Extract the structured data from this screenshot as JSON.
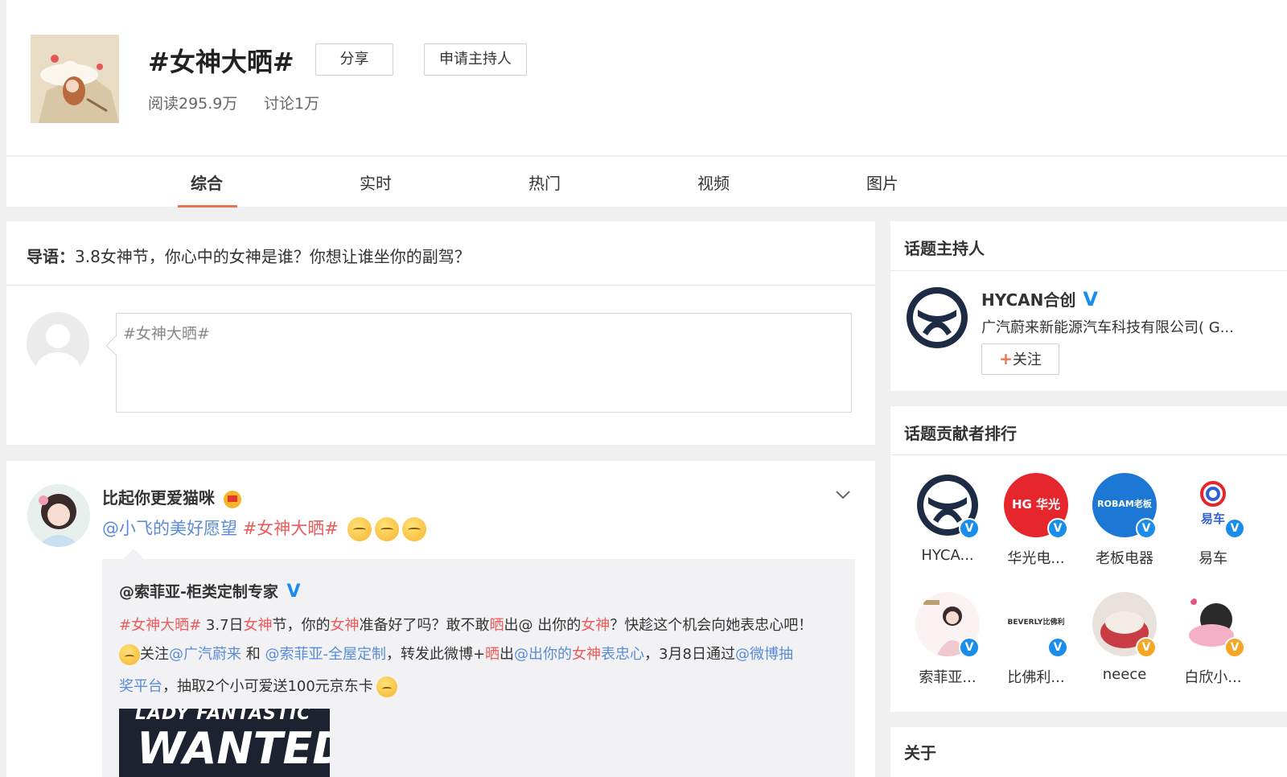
{
  "topic": {
    "title": "#女神大晒#",
    "share_label": "分享",
    "apply_host_label": "申请主持人",
    "read_stat": "阅读295.9万",
    "discuss_stat": "讨论1万"
  },
  "tabs": [
    {
      "label": "综合",
      "active": true
    },
    {
      "label": "实时",
      "active": false
    },
    {
      "label": "热门",
      "active": false
    },
    {
      "label": "视频",
      "active": false
    },
    {
      "label": "图片",
      "active": false
    }
  ],
  "intro": {
    "prefix": "导语：",
    "text": "3.8女神节，你心中的女神是谁？你想让谁坐你的副驾？"
  },
  "composer": {
    "value": "#女神大晒#"
  },
  "post": {
    "author": "比起你更爱猫咪",
    "mention": "@小飞的美好愿望",
    "hashtag": "#女神大晒#",
    "repost": {
      "author": "@索菲亚-柜类定制专家",
      "line1": {
        "hashtag": "#女神大晒#",
        "t1": " 3.7日",
        "w1": "女神",
        "t2": "节，你的",
        "w2": "女神",
        "t3": "准备好了吗？敢不敢",
        "w3": "晒",
        "t4": "出@ 出你的",
        "w4": "女神",
        "t5": "？快趁这个机会向她表忠心吧！"
      },
      "line2": {
        "t1": "关注",
        "m1": "@广汽蔚来",
        "t2": " 和 ",
        "m2": "@索菲亚-全屋定制",
        "t3": "，转发此微博+",
        "w1": "晒",
        "t4": "出",
        "m3a": "@出你的",
        "w2": "女神",
        "m3b": "表忠心",
        "t5": "，3月8日通过",
        "m4": "@微博抽"
      },
      "line3": {
        "m1": "奖平台",
        "t1": "，抽取2个小可爱送100元京东卡"
      },
      "image_text_top": "LADY FANTASTIC",
      "image_text_main": "WANTED"
    }
  },
  "host": {
    "section_title": "话题主持人",
    "name": "HYCAN合创",
    "desc": "广汽蔚来新能源汽车科技有限公司( G...",
    "follow_label": "关注"
  },
  "contributors": {
    "section_title": "话题贡献者排行",
    "items": [
      {
        "name": "HYCA..."
      },
      {
        "name": "华光电..."
      },
      {
        "name": "老板电器"
      },
      {
        "name": "易车"
      },
      {
        "name": "索菲亚..."
      },
      {
        "name": "比佛利..."
      },
      {
        "name": "neece"
      },
      {
        "name": "白欣小..."
      }
    ],
    "logo_text": {
      "huaguang": "HG 华光",
      "robam": "ROBAM老板",
      "yiche": "易车",
      "beverly": "BEVERLY比佛利"
    }
  },
  "about": {
    "section_title": "关于"
  },
  "colors": {
    "accent": "#eb7350",
    "link": "#5a8bd8",
    "highlight": "#eb5b5b",
    "verified_blue": "#1a8ceb",
    "verified_gold": "#f5a623"
  }
}
